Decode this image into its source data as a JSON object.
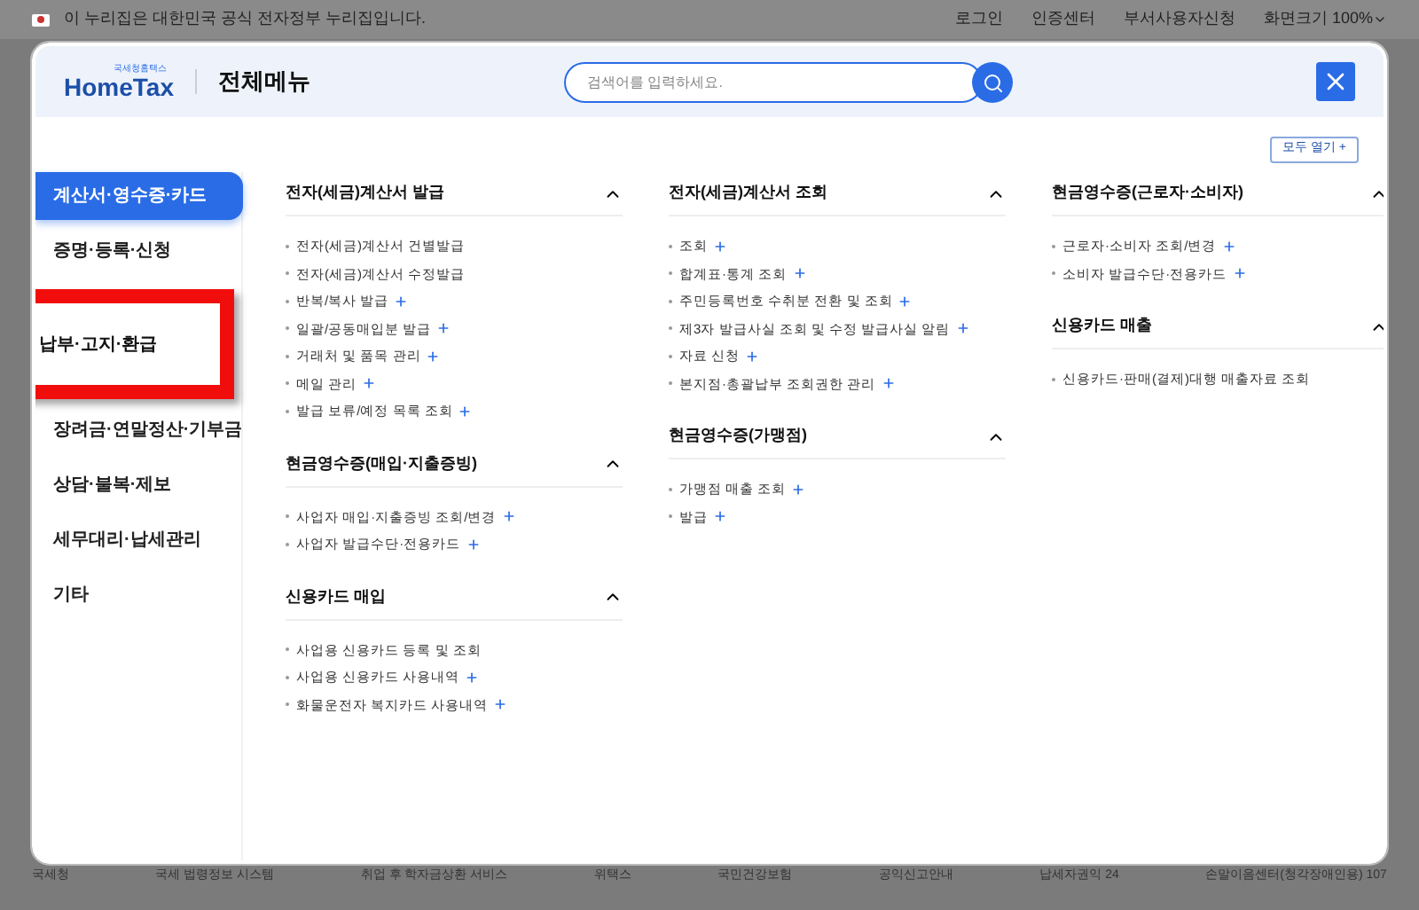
{
  "gov_bar": {
    "notice": "이 누리집은 대한민국 공식 전자정부 누리집입니다.",
    "links": [
      "로그인",
      "인증센터",
      "부서사용자신청"
    ],
    "zoom": "화면크기 100%"
  },
  "header": {
    "logo_small": "국세청홈택스",
    "logo": "HomeTax",
    "title": "전체메뉴",
    "search": {
      "placeholder": "검색어를 입력하세요."
    }
  },
  "open_all": "모두 열기 +",
  "sidebar": [
    {
      "label": "계산서·영수증·카드",
      "selected": true,
      "kind": "item"
    },
    {
      "label": "증명·등록·신청",
      "selected": false,
      "kind": "item"
    },
    {
      "label": "납부·고지·환급",
      "selected": false,
      "kind": "callout"
    },
    {
      "label": "장려금·연말정산·기부금",
      "selected": false,
      "kind": "item"
    },
    {
      "label": "상담·불복·제보",
      "selected": false,
      "kind": "item"
    },
    {
      "label": "세무대리·납세관리",
      "selected": false,
      "kind": "item"
    },
    {
      "label": "기타",
      "selected": false,
      "kind": "item"
    }
  ],
  "columns": [
    [
      {
        "title": "전자(세금)계산서 발급",
        "expanded": true,
        "items": [
          {
            "text": "전자(세금)계산서 건별발급",
            "plus": false
          },
          {
            "text": "전자(세금)계산서 수정발급",
            "plus": false
          },
          {
            "text": "반복/복사 발급",
            "plus": true
          },
          {
            "text": "일괄/공동매입분 발급",
            "plus": true
          },
          {
            "text": "거래처 및 품목 관리",
            "plus": true
          },
          {
            "text": "메일 관리",
            "plus": true
          },
          {
            "text": "발급 보류/예정 목록 조회",
            "plus": true
          }
        ]
      },
      {
        "title": "현금영수증(매입·지출증빙)",
        "expanded": true,
        "items": [
          {
            "text": "사업자 매입·지출증빙 조회/변경",
            "plus": true
          },
          {
            "text": "사업자 발급수단·전용카드",
            "plus": true
          }
        ]
      },
      {
        "title": "신용카드 매입",
        "expanded": true,
        "items": [
          {
            "text": "사업용 신용카드 등록 및 조회",
            "plus": false
          },
          {
            "text": "사업용 신용카드 사용내역",
            "plus": true
          },
          {
            "text": "화물운전자 복지카드 사용내역",
            "plus": true
          }
        ]
      }
    ],
    [
      {
        "title": "전자(세금)계산서 조회",
        "expanded": true,
        "items": [
          {
            "text": "조회",
            "plus": true
          },
          {
            "text": "합계표·통계 조회",
            "plus": true
          },
          {
            "text": "주민등록번호 수취분 전환 및 조회",
            "plus": true
          },
          {
            "text": "제3자 발급사실 조회 및 수정 발급사실 알림",
            "plus": true
          },
          {
            "text": "자료 신청",
            "plus": true
          },
          {
            "text": "본지점·총괄납부 조회권한 관리",
            "plus": true
          }
        ]
      },
      {
        "title": "현금영수증(가맹점)",
        "expanded": true,
        "items": [
          {
            "text": "가맹점 매출 조회",
            "plus": true
          },
          {
            "text": "발급",
            "plus": true
          }
        ]
      }
    ],
    [
      {
        "title": "현금영수증(근로자·소비자)",
        "expanded": true,
        "items": [
          {
            "text": "근로자·소비자 조회/변경",
            "plus": true
          },
          {
            "text": "소비자 발급수단·전용카드",
            "plus": true
          }
        ]
      },
      {
        "title": "신용카드 매출",
        "expanded": true,
        "items": [
          {
            "text": "신용카드·판매(결제)대행 매출자료 조회",
            "plus": false
          }
        ]
      }
    ]
  ],
  "footer": [
    "국세청",
    "국세 법령정보 시스템",
    "취업 후 학자금상환 서비스",
    "위택스",
    "국민건강보험",
    "공익신고안내",
    "납세자권익 24",
    "손말이음센터(청각장애인용) 107"
  ]
}
